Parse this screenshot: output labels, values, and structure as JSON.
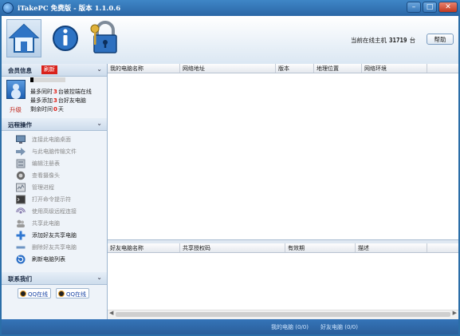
{
  "window": {
    "title": "iTakePC 免费版 - 版本 1.1.0.6",
    "controls": {
      "minimize": "–",
      "maximize": "□",
      "close": "✕"
    }
  },
  "toolbar": {
    "icons": [
      "home-icon",
      "info-icon",
      "padlock-icon"
    ],
    "online_label": "当前在线主机",
    "online_count": "31719",
    "online_unit": "台",
    "help_label": "帮助"
  },
  "member": {
    "title": "会员信息",
    "refresh_label": "刷新",
    "upgrade_label": "升级",
    "line1": {
      "pre": "最多同时",
      "num": "3",
      "post": "台被控端在线"
    },
    "line2": {
      "pre": "最多添加",
      "num": "3",
      "post": "台好友电脑"
    },
    "line3": {
      "pre": "剩余时间",
      "num": "0",
      "post": "天"
    }
  },
  "remote_ops": {
    "title": "远程操作",
    "items": [
      {
        "label": "连接此电脑桌面",
        "enabled": false,
        "icon": "monitor-icon"
      },
      {
        "label": "与此电脑传输文件",
        "enabled": false,
        "icon": "arrow-right-icon"
      },
      {
        "label": "编辑注册表",
        "enabled": false,
        "icon": "registry-icon"
      },
      {
        "label": "查看摄像头",
        "enabled": false,
        "icon": "webcam-icon"
      },
      {
        "label": "管理进程",
        "enabled": false,
        "icon": "process-icon"
      },
      {
        "label": "打开命令提示符",
        "enabled": false,
        "icon": "terminal-icon"
      },
      {
        "label": "使用高级远程连接",
        "enabled": false,
        "icon": "advanced-connect-icon"
      },
      {
        "label": "共享此电脑",
        "enabled": false,
        "icon": "share-icon"
      },
      {
        "label": "添加好友共享电脑",
        "enabled": true,
        "icon": "plus-icon"
      },
      {
        "label": "删除好友共享电脑",
        "enabled": false,
        "icon": "minus-icon"
      },
      {
        "label": "刷新电脑列表",
        "enabled": true,
        "icon": "refresh-icon"
      }
    ]
  },
  "contact": {
    "title": "联系我们",
    "qq1": "QQ在线",
    "qq2": "QQ在线"
  },
  "my_computers": {
    "columns": [
      "我的电脑名称",
      "网络地址",
      "版本",
      "地理位置",
      "网络环境"
    ]
  },
  "friend_computers": {
    "columns": [
      "好友电脑名称",
      "共享授权码",
      "有效期",
      "描述"
    ]
  },
  "status_bar": {
    "mine": "我的电脑 (0/0)",
    "friends": "好友电脑 (0/0)"
  },
  "colors": {
    "frame": "#2b6ea8",
    "accent_red": "#d9211a",
    "sidebar_bg": "#eef3f9"
  }
}
